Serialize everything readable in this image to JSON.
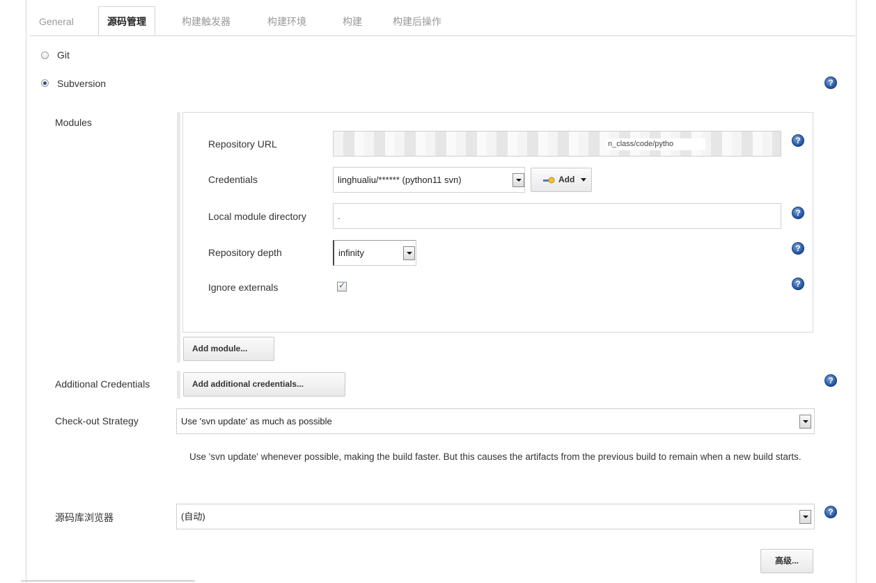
{
  "tabs": [
    "General",
    "源码管理",
    "构建触发器",
    "构建环境",
    "构建",
    "构建后操作"
  ],
  "scm": {
    "git_label": "Git",
    "svn_label": "Subversion",
    "selected": "Subversion"
  },
  "modules": {
    "section_label": "Modules",
    "repo_url_label": "Repository URL",
    "repo_url_visible": "n_class/code/pytho",
    "credentials_label": "Credentials",
    "credentials_value": "linghualiu/****** (python11  svn)",
    "add_button": "Add",
    "local_dir_label": "Local module directory",
    "local_dir_value": ".",
    "depth_label": "Repository depth",
    "depth_value": "infinity",
    "ignore_externals_label": "Ignore externals",
    "ignore_externals_checked": true,
    "add_module_button": "Add module..."
  },
  "additional_credentials": {
    "label": "Additional Credentials",
    "button": "Add additional credentials..."
  },
  "checkout": {
    "label": "Check-out Strategy",
    "value": "Use 'svn update' as much as possible",
    "description": "Use 'svn update' whenever possible, making the build faster. But this causes the artifacts from the previous build to remain when a new build starts."
  },
  "browser": {
    "label": "源码库浏览器",
    "value": "(自动)"
  },
  "advanced_button": "高级...",
  "help_glyph": "?",
  "icons": {
    "help": "help-icon",
    "key": "key-icon",
    "dropdown": "chevron-down-icon"
  },
  "colors": {
    "help_blue": "#1d4f9c",
    "border": "#cfcfcf"
  }
}
